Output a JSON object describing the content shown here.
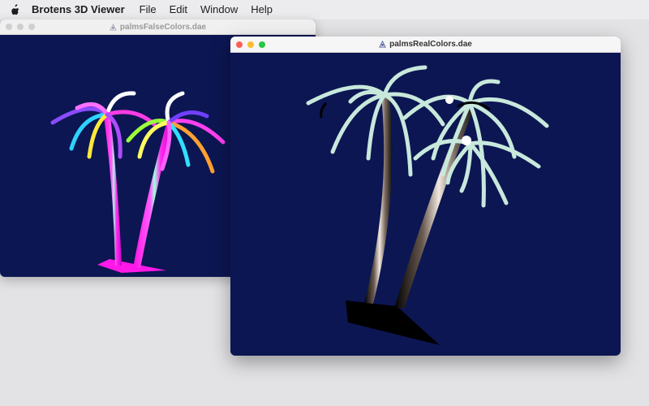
{
  "menubar": {
    "apple_icon": "apple-logo-icon",
    "app_name": "Brotens 3D Viewer",
    "items": [
      "File",
      "Edit",
      "Window",
      "Help"
    ]
  },
  "windows": {
    "false_colors": {
      "title": "palmsFalseColors.dae",
      "active": false,
      "viewport_bg": "#0c1652",
      "model_color": "#ff18e8"
    },
    "real_colors": {
      "title": "palmsRealColors.dae",
      "active": true,
      "viewport_bg": "#0c1652",
      "traffic_lights": {
        "close": "#fe5f57",
        "minimize": "#febc2e",
        "zoom": "#28c840"
      },
      "leaf_color": "#c8e8dc",
      "trunk_color": "#b8a89a"
    }
  }
}
